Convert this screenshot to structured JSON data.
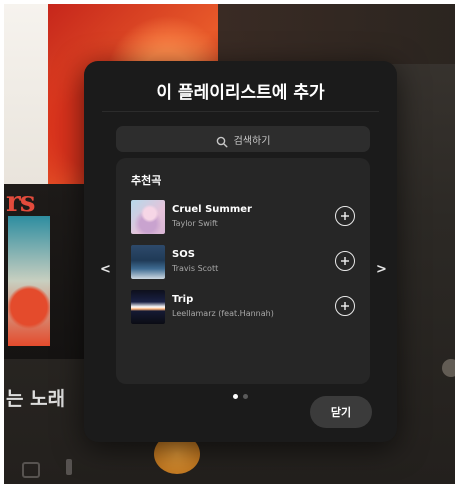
{
  "background": {
    "korean_label": "는 노래",
    "partial_text": "rs"
  },
  "dialog": {
    "title": "이 플레이리스트에 추가",
    "search": {
      "placeholder": "검색하기",
      "icon": "search-icon"
    },
    "section_title": "추천곡",
    "songs": [
      {
        "title": "Cruel Summer",
        "artist": "Taylor Swift",
        "action_icon": "plus-circle-icon"
      },
      {
        "title": "SOS",
        "artist": "Travis Scott",
        "action_icon": "plus-circle-icon"
      },
      {
        "title": "Trip",
        "artist": "Leellamarz (feat.Hannah)",
        "action_icon": "plus-circle-icon"
      }
    ],
    "nav": {
      "prev": "<",
      "next": ">"
    },
    "pagination": {
      "current_page": 1,
      "total_pages": 2
    },
    "close_label": "닫기"
  },
  "colors": {
    "dialog_bg": "#1b1b1b",
    "panel_bg": "#262626",
    "search_bg": "#2d2d2d",
    "close_button_bg": "#3b3b3b"
  }
}
